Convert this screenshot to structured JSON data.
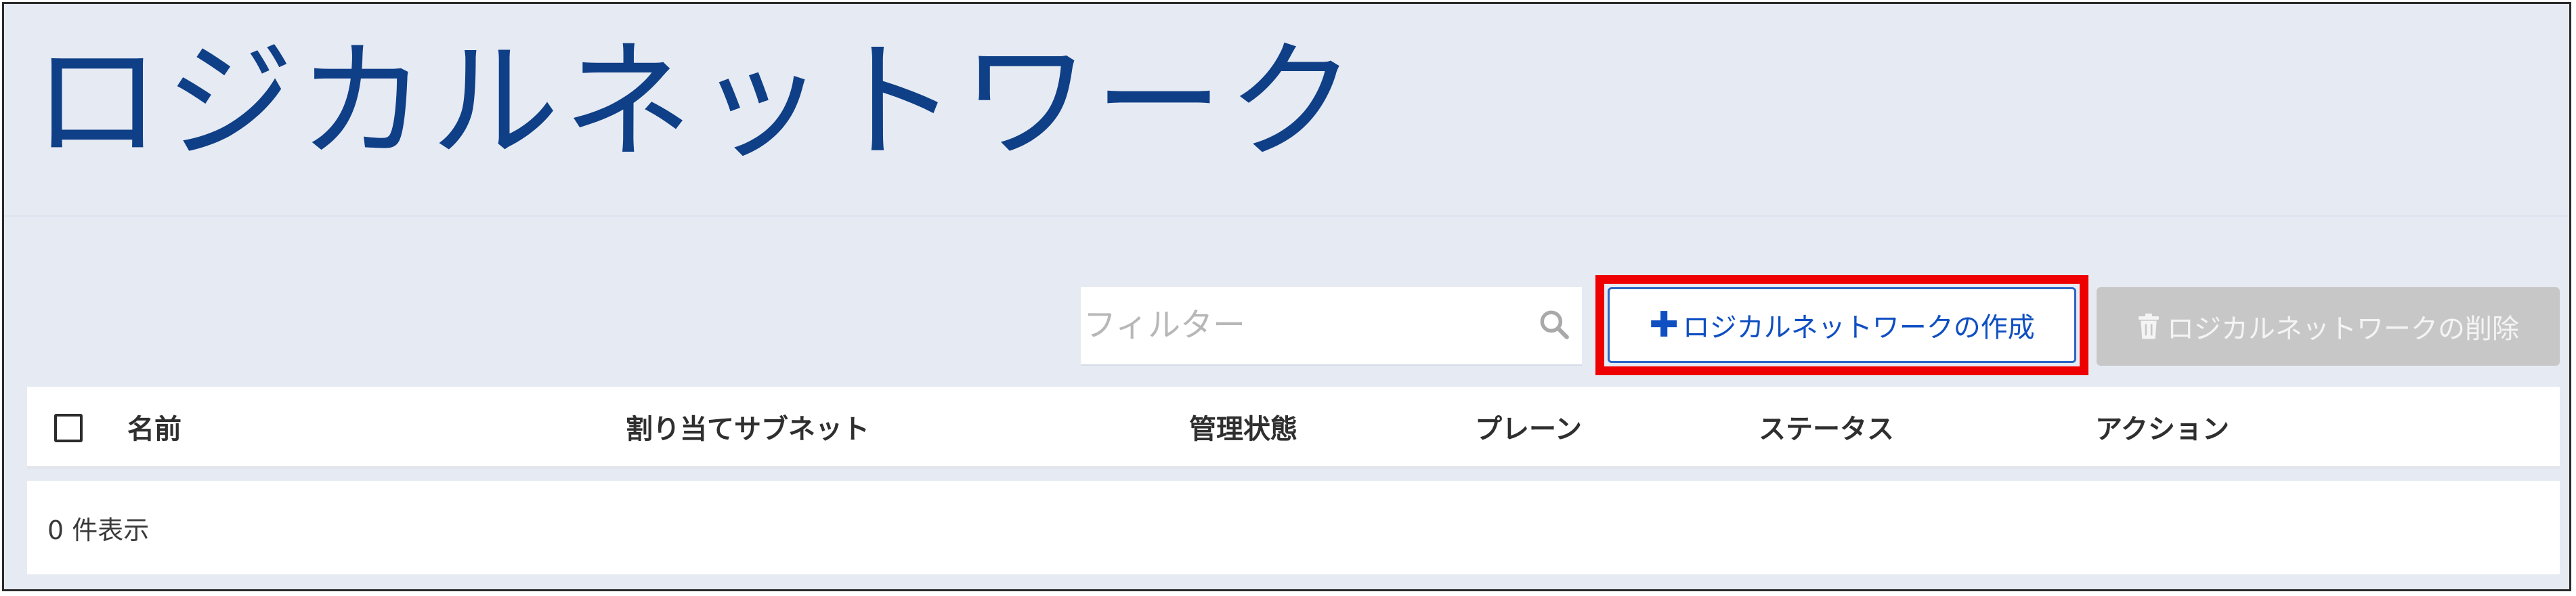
{
  "page": {
    "title": "ロジカルネットワーク"
  },
  "toolbar": {
    "filter_placeholder": "フィルター",
    "create_label": "ロジカルネットワークの作成",
    "create_icon": "plus-icon",
    "delete_label": "ロジカルネットワークの削除",
    "delete_icon": "trash-icon",
    "delete_disabled": true
  },
  "table": {
    "columns": [
      "名前",
      "割り当てサブネット",
      "管理状態",
      "プレーン",
      "ステータス",
      "アクション"
    ],
    "rows": [],
    "count_text": "0 件表示"
  },
  "colors": {
    "title": "#0f3f86",
    "background": "#e6eaf3",
    "primary_button_text": "#0f4fc2",
    "primary_button_border": "#2a66c4",
    "disabled_button": "#c7c7c7",
    "highlight": "#ee0000"
  }
}
